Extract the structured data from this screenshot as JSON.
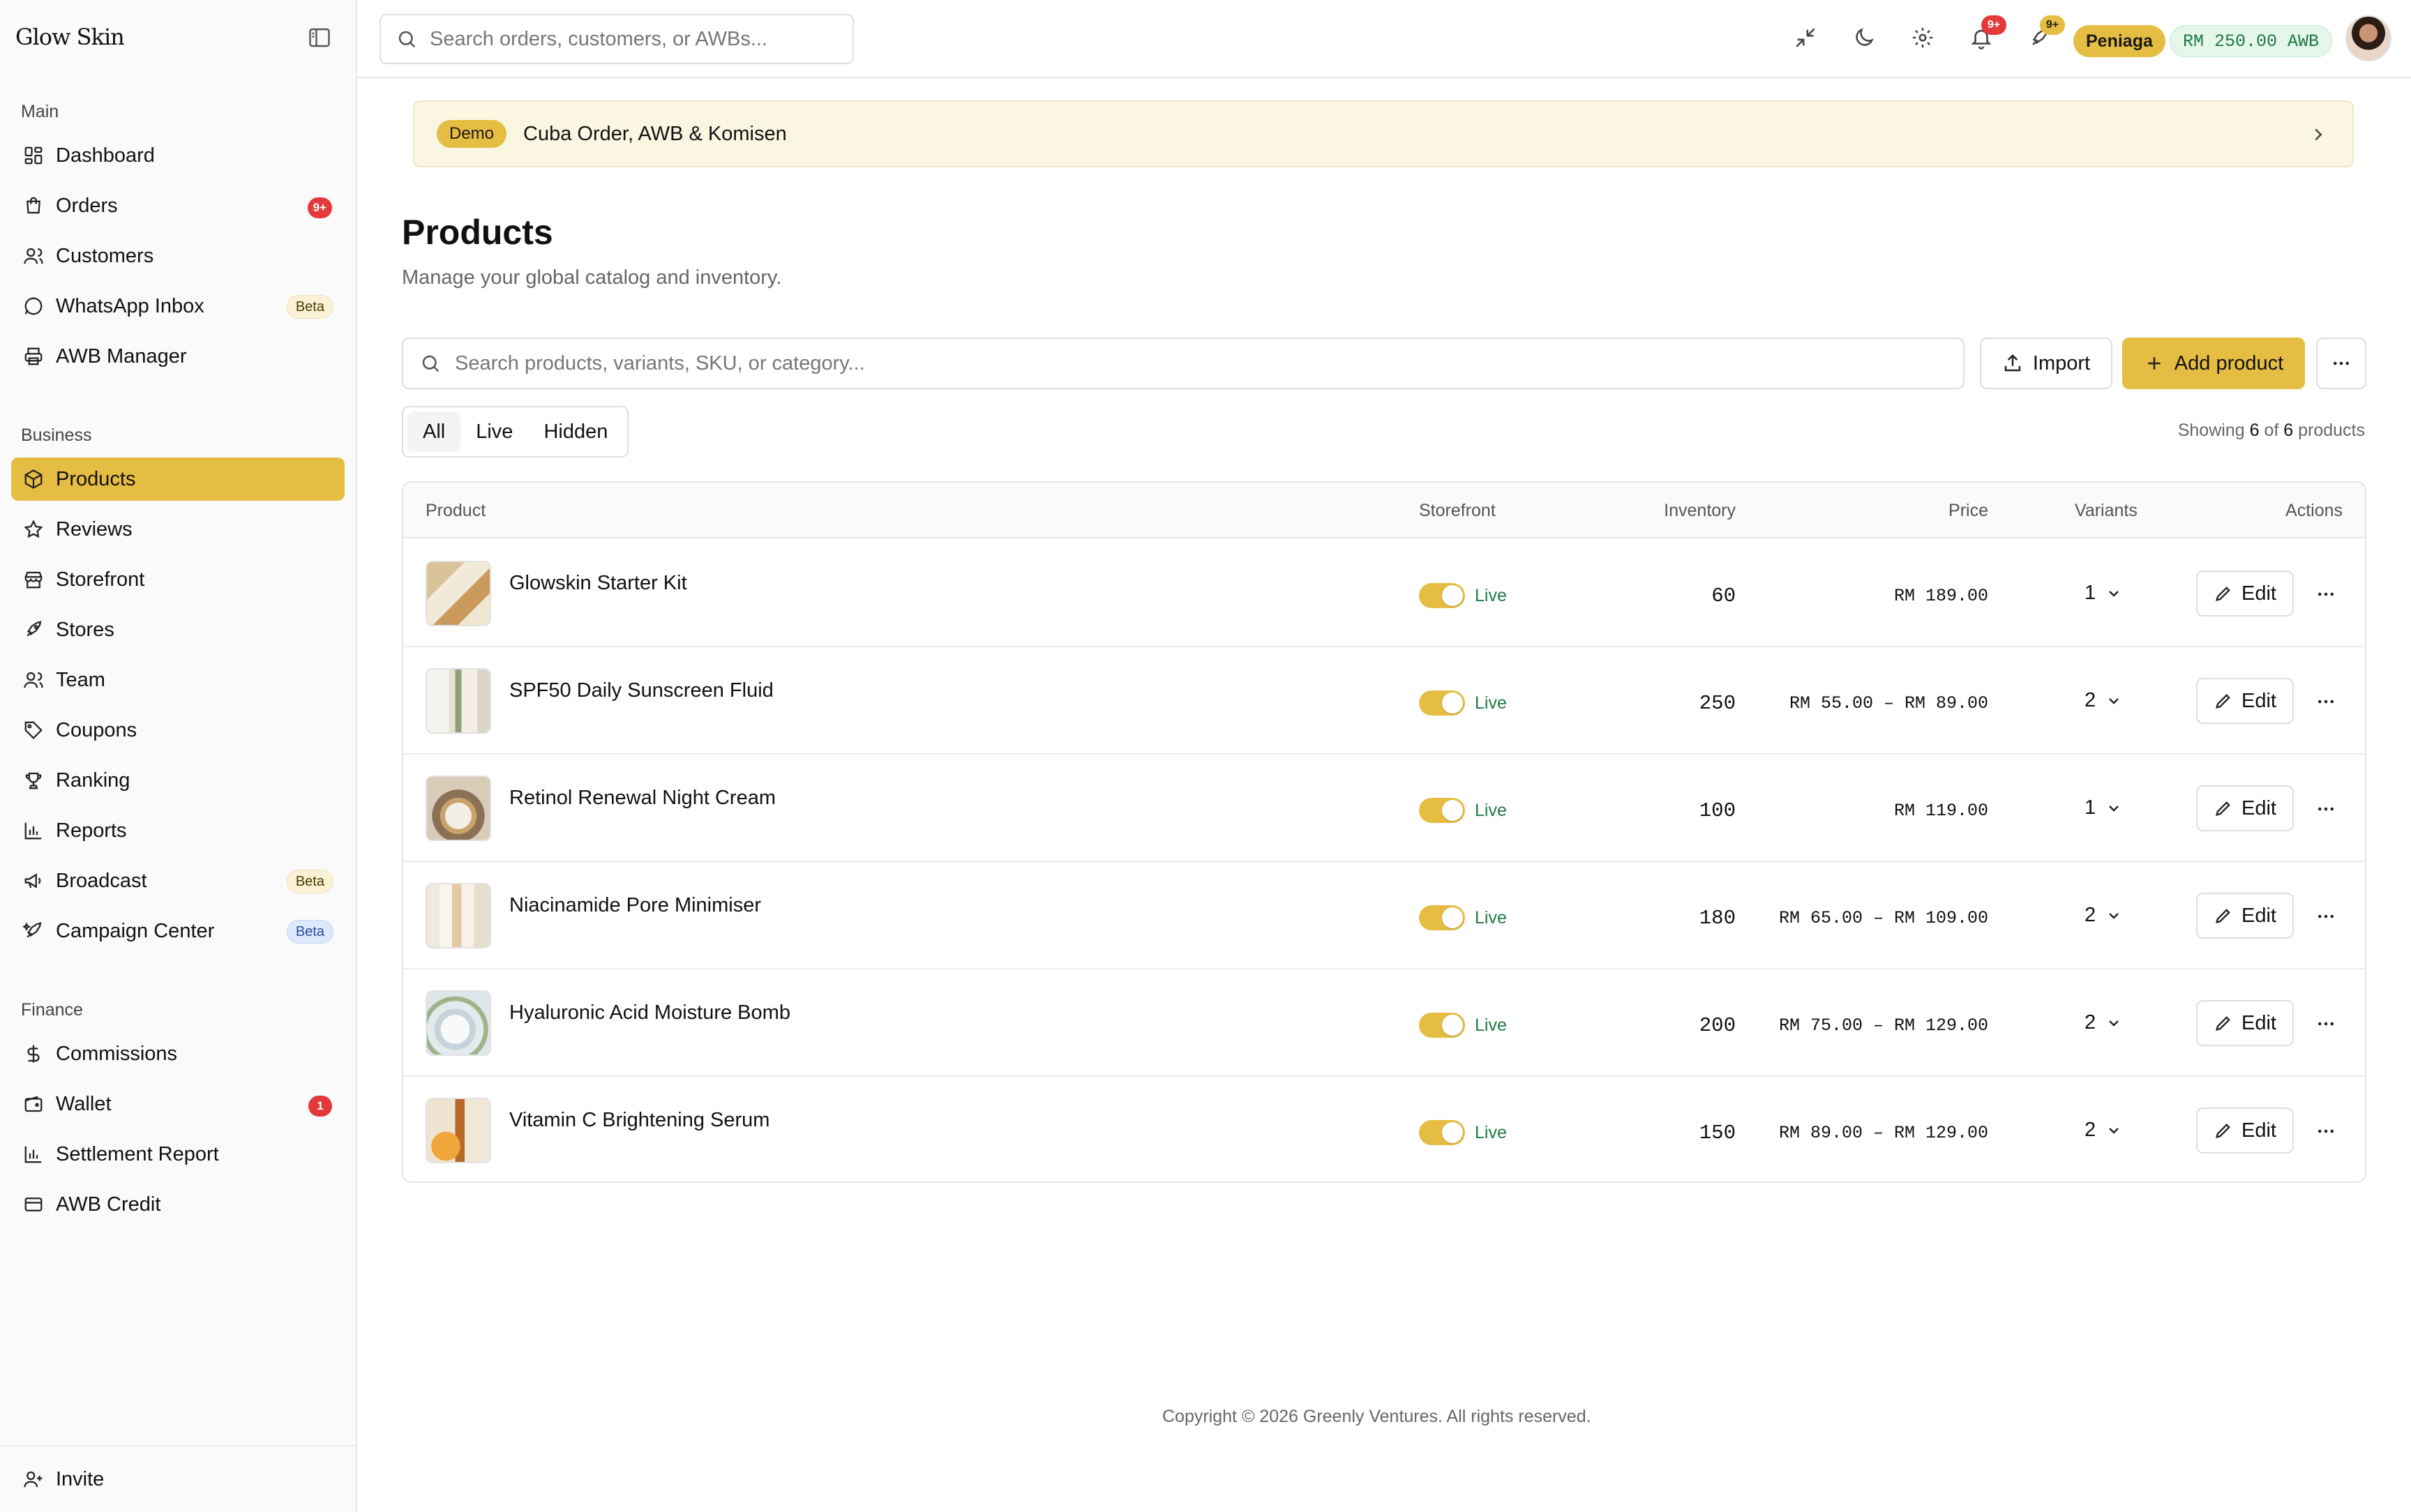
{
  "app": {
    "brand": "Glow Skin"
  },
  "search": {
    "placeholder": "Search orders, customers, or AWBs..."
  },
  "topbar": {
    "notifications_badge": "9+",
    "rocket_badge": "9+",
    "role_badge": "Peniaga",
    "awb_balance": "RM 250.00 AWB"
  },
  "sidebar": {
    "sections": [
      {
        "label": "Main",
        "items": [
          {
            "label": "Dashboard",
            "icon": "dashboard-icon"
          },
          {
            "label": "Orders",
            "icon": "shopping-bag-icon",
            "count": "9+"
          },
          {
            "label": "Customers",
            "icon": "users-icon"
          },
          {
            "label": "WhatsApp Inbox",
            "icon": "chat-bubble-icon",
            "badge": "Beta"
          },
          {
            "label": "AWB Manager",
            "icon": "printer-icon"
          }
        ]
      },
      {
        "label": "Business",
        "items": [
          {
            "label": "Products",
            "icon": "box-icon",
            "active": true
          },
          {
            "label": "Reviews",
            "icon": "star-icon"
          },
          {
            "label": "Storefront",
            "icon": "store-icon"
          },
          {
            "label": "Stores",
            "icon": "rocket-icon"
          },
          {
            "label": "Team",
            "icon": "team-icon"
          },
          {
            "label": "Coupons",
            "icon": "tag-icon"
          },
          {
            "label": "Ranking",
            "icon": "trophy-icon"
          },
          {
            "label": "Reports",
            "icon": "bar-chart-icon"
          },
          {
            "label": "Broadcast",
            "icon": "megaphone-icon",
            "badge": "Beta"
          },
          {
            "label": "Campaign Center",
            "icon": "sparkle-rocket-icon",
            "badge": "Beta"
          }
        ]
      },
      {
        "label": "Finance",
        "items": [
          {
            "label": "Commissions",
            "icon": "dollar-icon"
          },
          {
            "label": "Wallet",
            "icon": "wallet-icon",
            "count": "1"
          },
          {
            "label": "Settlement Report",
            "icon": "bar-chart-icon"
          },
          {
            "label": "AWB Credit",
            "icon": "credit-card-icon"
          }
        ]
      }
    ],
    "invite": "Invite"
  },
  "banner": {
    "tag": "Demo",
    "text": "Cuba Order, AWB & Komisen"
  },
  "page": {
    "title": "Products",
    "subtitle": "Manage your global catalog and inventory.",
    "search_placeholder": "Search products, variants, SKU, or category...",
    "import_label": "Import",
    "add_label": "Add product",
    "tabs": [
      "All",
      "Live",
      "Hidden"
    ],
    "showing_prefix": "Showing",
    "showing_count": "6",
    "showing_of": "of",
    "showing_total": "6",
    "showing_suffix": "products"
  },
  "table": {
    "columns": [
      "Product",
      "Storefront",
      "Inventory",
      "Price",
      "Variants",
      "Actions"
    ],
    "edit_label": "Edit",
    "rows": [
      {
        "name": "Glowskin Starter Kit",
        "status": "Live",
        "inventory": "60",
        "price": "RM 189.00",
        "variants": "1"
      },
      {
        "name": "SPF50 Daily Sunscreen Fluid",
        "status": "Live",
        "inventory": "250",
        "price": "RM 55.00 – RM 89.00",
        "variants": "2"
      },
      {
        "name": "Retinol Renewal Night Cream",
        "status": "Live",
        "inventory": "100",
        "price": "RM 119.00",
        "variants": "1"
      },
      {
        "name": "Niacinamide Pore Minimiser",
        "status": "Live",
        "inventory": "180",
        "price": "RM 65.00 – RM 109.00",
        "variants": "2"
      },
      {
        "name": "Hyaluronic Acid Moisture Bomb",
        "status": "Live",
        "inventory": "200",
        "price": "RM 75.00 – RM 129.00",
        "variants": "2"
      },
      {
        "name": "Vitamin C Brightening Serum",
        "status": "Live",
        "inventory": "150",
        "price": "RM 89.00 – RM 129.00",
        "variants": "2"
      }
    ]
  },
  "footer": {
    "text": "Copyright © 2026 Greenly Ventures. All rights reserved."
  },
  "colors": {
    "accent": "#e6bd43",
    "live": "#1f7a43",
    "alert": "#e5383b"
  }
}
